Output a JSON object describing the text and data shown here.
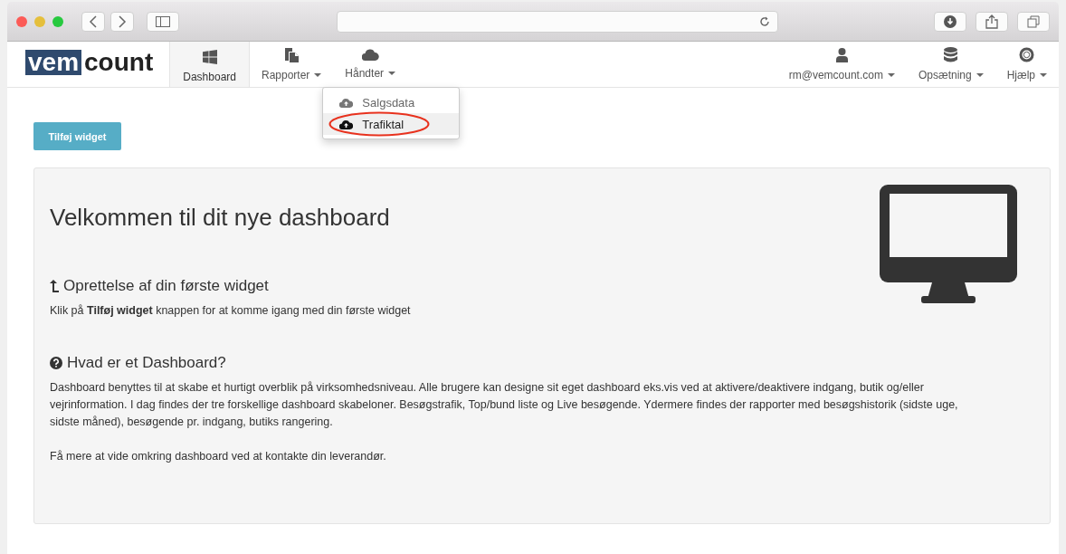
{
  "nav": {
    "logo": {
      "boxed": "vem",
      "plain": "count"
    },
    "left": [
      {
        "label": "Dashboard",
        "kind": "windows",
        "dropdown": false,
        "selected": true
      },
      {
        "label": "Rapporter",
        "kind": "files",
        "dropdown": true,
        "selected": false
      },
      {
        "label": "Håndter",
        "kind": "cloud",
        "dropdown": true,
        "selected": false,
        "menu": [
          {
            "label": "Salgsdata",
            "selected": false,
            "circled": false
          },
          {
            "label": "Trafiktal",
            "selected": true,
            "circled": true
          }
        ]
      }
    ],
    "right": [
      {
        "label": "rm@vemcount.com",
        "kind": "user",
        "dropdown": true,
        "selected": false
      },
      {
        "label": "Opsætning",
        "kind": "database",
        "dropdown": true,
        "selected": false
      },
      {
        "label": "Hjælp",
        "kind": "lifebuoy",
        "dropdown": true,
        "selected": false
      }
    ]
  },
  "add_button": "Tilføj widget",
  "welcome": {
    "title": "Velkommen til dit nye dashboard",
    "sections": [
      {
        "kind": "arrow",
        "heading": "Oprettelse af din første widget",
        "paragraphs": [
          "Klik på **Tilføj widget** knappen for at komme igang med din første widget"
        ]
      },
      {
        "kind": "question",
        "heading": "Hvad er et Dashboard?",
        "paragraphs": [
          "Dashboard benyttes til at skabe et hurtigt overblik på virksomhedsniveau. Alle brugere kan designe sit eget dashboard eks.vis ved at aktivere/deaktivere indgang, butik og/eller vejrinformation. I dag findes der tre forskellige dashboard skabeloner. Besøgstrafik, Top/bund liste og Live besøgende. Ydermere findes der rapporter med besøgshistorik (sidste uge, sidste måned), besøgende pr. indgang, butiks rangering.",
          "Få mere at vide omkring dashboard ved at kontakte din leverandør."
        ]
      }
    ]
  }
}
